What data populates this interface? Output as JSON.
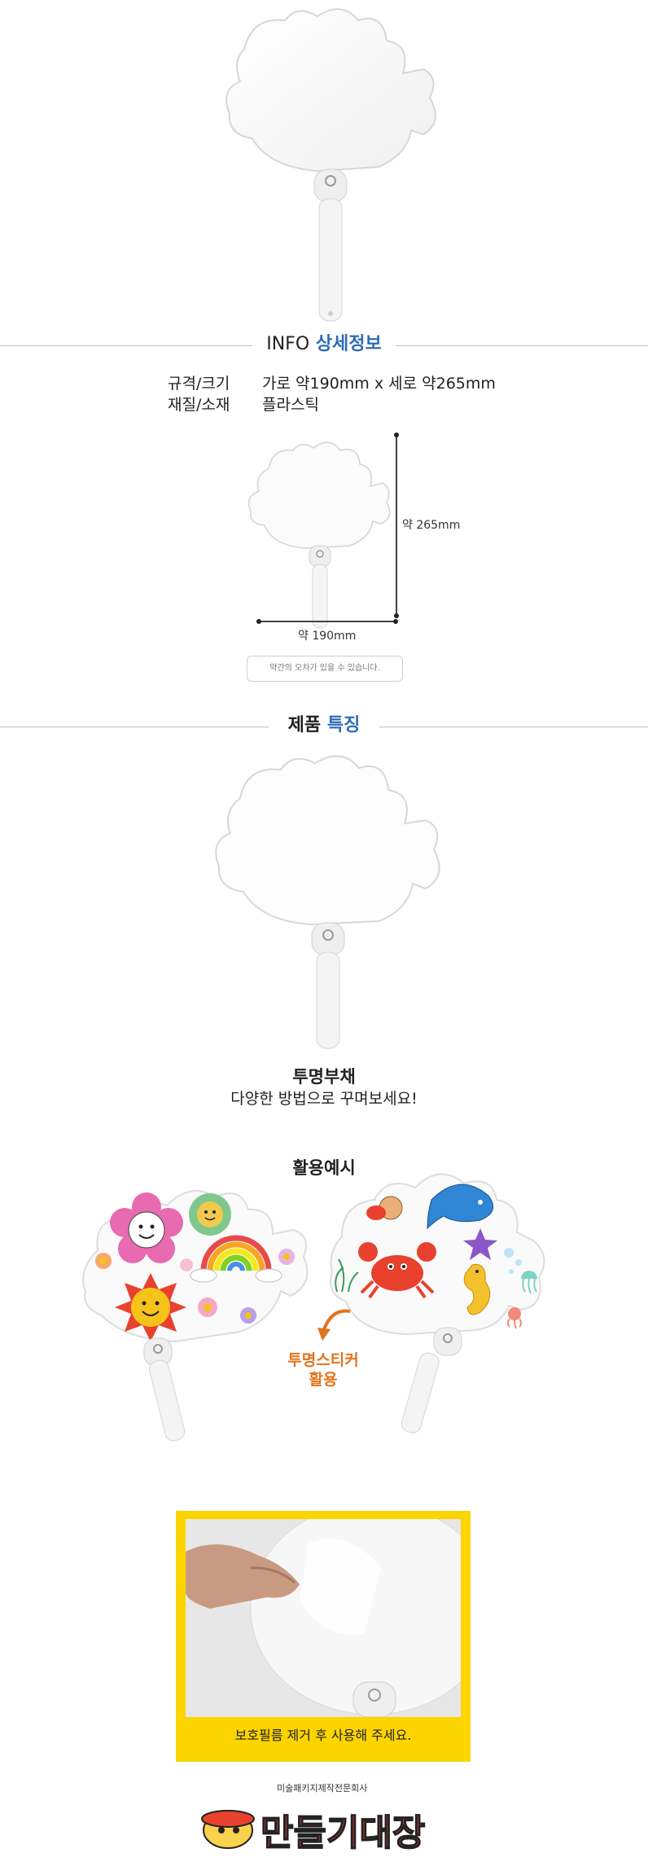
{
  "info": {
    "title_en": "INFO",
    "title_ko": "상세정보",
    "specs": [
      {
        "key": "규격/크기",
        "value": "가로 약190mm x 세로 약265mm"
      },
      {
        "key": "재질/소재",
        "value": "플라스틱"
      }
    ],
    "dim_height": "약 265mm",
    "dim_width": "약 190mm",
    "note": "약간의 오차가 있을 수 있습니다."
  },
  "features": {
    "title_a": "제품",
    "title_b": "특징",
    "item_title": "투명부채",
    "item_sub": "다양한 방법으로 꾸며보세요!"
  },
  "usage": {
    "title": "활용예시",
    "sticker_label_1": "투명스티커",
    "sticker_label_2": "활용"
  },
  "photo": {
    "caption": "보호필름 제거 후 사용해 주세요."
  },
  "logo": {
    "tagline": "미술패키지제작전문회사",
    "name": "만들기대장"
  },
  "colors": {
    "accent_blue": "#2f6db5",
    "accent_orange": "#e3731b",
    "photo_frame": "#fcd500"
  }
}
